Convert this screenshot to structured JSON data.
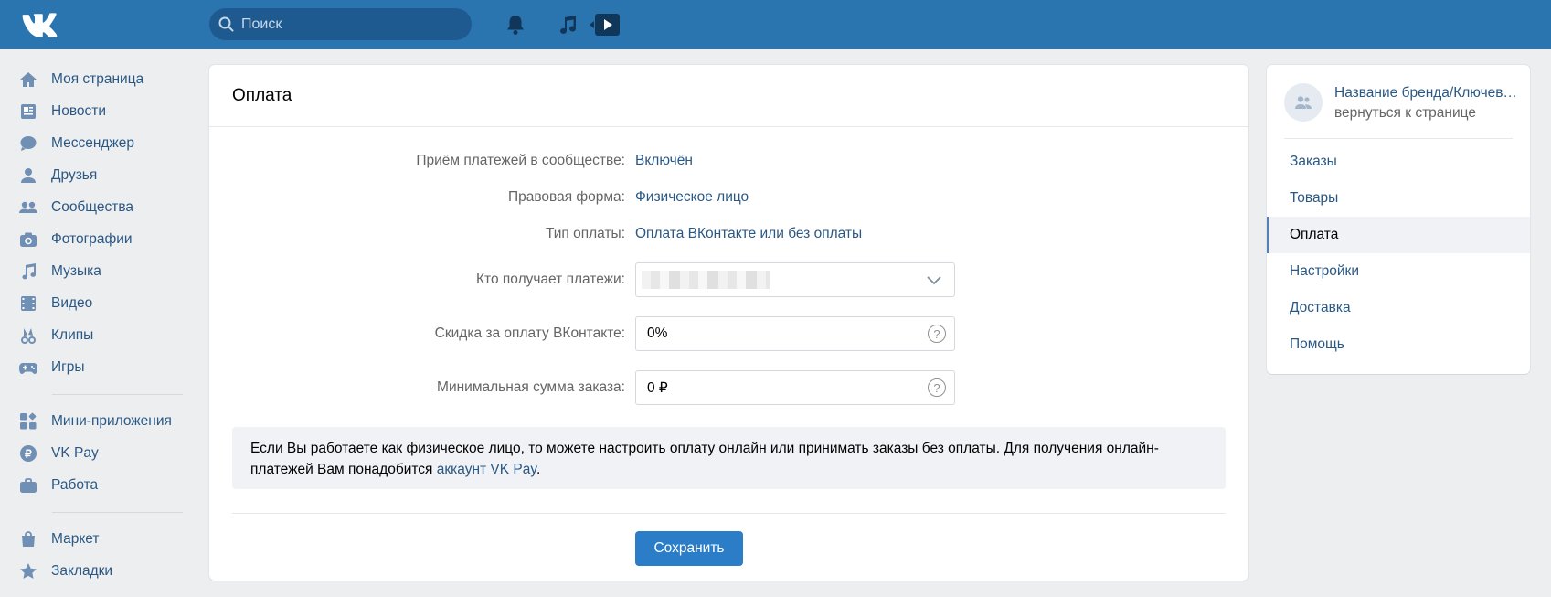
{
  "header": {
    "search_placeholder": "Поиск"
  },
  "sidebar": {
    "items": [
      {
        "label": "Моя страница",
        "icon": "home-icon"
      },
      {
        "label": "Новости",
        "icon": "news-icon"
      },
      {
        "label": "Мессенджер",
        "icon": "messenger-icon"
      },
      {
        "label": "Друзья",
        "icon": "friends-icon"
      },
      {
        "label": "Сообщества",
        "icon": "communities-icon"
      },
      {
        "label": "Фотографии",
        "icon": "camera-icon"
      },
      {
        "label": "Музыка",
        "icon": "music-icon"
      },
      {
        "label": "Видео",
        "icon": "video-icon"
      },
      {
        "label": "Клипы",
        "icon": "clips-icon"
      },
      {
        "label": "Игры",
        "icon": "games-icon"
      },
      {
        "label": "Мини-приложения",
        "icon": "mini-apps-icon"
      },
      {
        "label": "VK Pay",
        "icon": "vk-pay-icon"
      },
      {
        "label": "Работа",
        "icon": "briefcase-icon"
      },
      {
        "label": "Маркет",
        "icon": "market-bag-icon"
      },
      {
        "label": "Закладки",
        "icon": "star-icon"
      }
    ]
  },
  "main": {
    "title": "Оплата",
    "rows": {
      "payments_label": "Приём платежей в сообществе:",
      "payments_value": "Включён",
      "legal_label": "Правовая форма:",
      "legal_value": "Физическое лицо",
      "paytype_label": "Тип оплаты:",
      "paytype_value": "Оплата ВКонтакте или без оплаты",
      "receiver_label": "Кто получает платежи:",
      "discount_label": "Скидка за оплату ВКонтакте:",
      "discount_value": "0%",
      "minsum_label": "Минимальная сумма заказа:",
      "minsum_value": "0 ₽"
    },
    "notice": {
      "text": "Если Вы работаете как физическое лицо, то можете настроить оплату онлайн или принимать заказы без оплаты. Для получения онлайн-платежей Вам понадобится ",
      "link": "аккаунт VK Pay",
      "end": "."
    },
    "save_label": "Сохранить"
  },
  "right": {
    "brand_name": "Название бренда/Ключевое слово",
    "back_label": "вернуться к странице",
    "items": [
      "Заказы",
      "Товары",
      "Оплата",
      "Настройки",
      "Доставка",
      "Помощь"
    ],
    "active_index": 2
  },
  "colors": {
    "header": "#2a74b0",
    "link": "#2a5885",
    "button": "#2a7dc6"
  }
}
